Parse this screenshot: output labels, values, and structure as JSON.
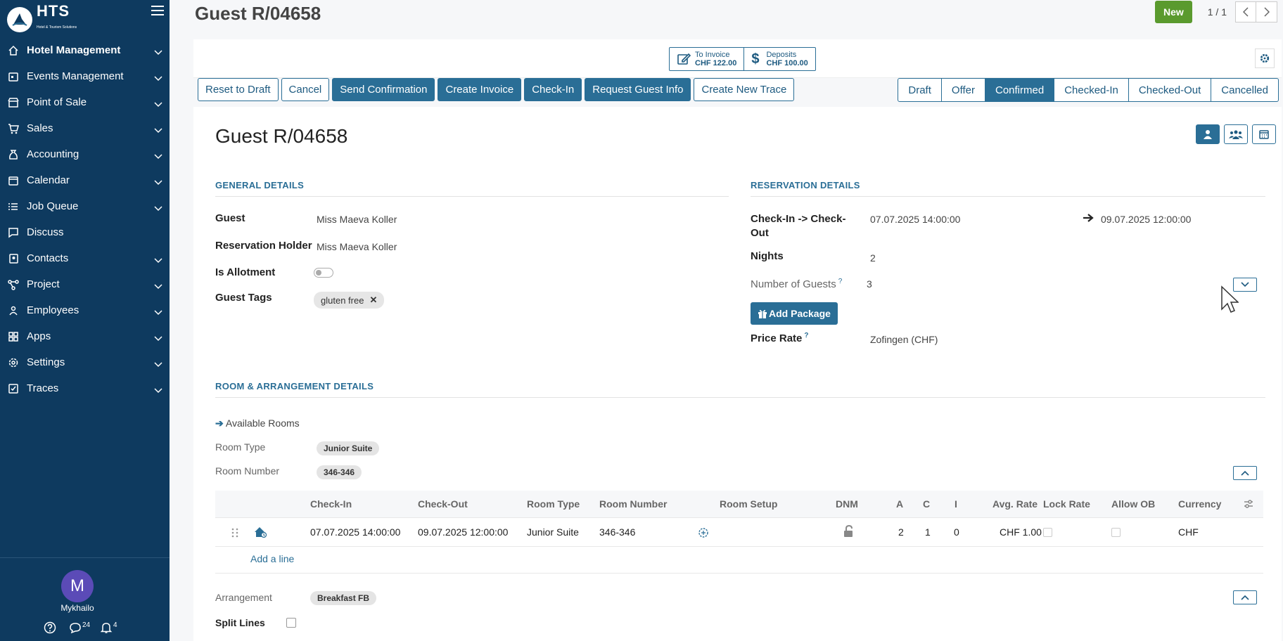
{
  "brand": {
    "name": "HTS",
    "tagline": "Hotel & Tourism Solutions"
  },
  "sidebar": {
    "items": [
      {
        "label": "Hotel Management",
        "icon": "home-icon",
        "active": true,
        "expandable": true
      },
      {
        "label": "Events Management",
        "icon": "calendar-event-icon",
        "expandable": true
      },
      {
        "label": "Point of Sale",
        "icon": "shop-icon",
        "expandable": true
      },
      {
        "label": "Sales",
        "icon": "cart-icon",
        "expandable": true
      },
      {
        "label": "Accounting",
        "icon": "money-bag-icon",
        "expandable": true
      },
      {
        "label": "Calendar",
        "icon": "calendar-icon",
        "expandable": true
      },
      {
        "label": "Job Queue",
        "icon": "list-icon",
        "expandable": true
      },
      {
        "label": "Discuss",
        "icon": "chat-icon",
        "expandable": false
      },
      {
        "label": "Contacts",
        "icon": "address-book-icon",
        "expandable": true
      },
      {
        "label": "Project",
        "icon": "project-icon",
        "expandable": true
      },
      {
        "label": "Employees",
        "icon": "people-icon",
        "expandable": true
      },
      {
        "label": "Apps",
        "icon": "apps-icon",
        "expandable": true
      },
      {
        "label": "Settings",
        "icon": "gear-icon",
        "expandable": true
      },
      {
        "label": "Traces",
        "icon": "checkbox-icon",
        "expandable": true
      }
    ],
    "user": {
      "initial": "M",
      "name": "Mykhailo"
    },
    "messages_count": "24",
    "notifications_count": "4"
  },
  "header": {
    "title": "Guest R/04658",
    "new_label": "New",
    "pager": "1 / 1"
  },
  "smart_buttons": {
    "invoice": {
      "title": "To Invoice",
      "value": "CHF 122.00"
    },
    "deposits": {
      "title": "Deposits",
      "value": "CHF 100.00"
    }
  },
  "actions": [
    "Reset to Draft",
    "Cancel",
    "Send Confirmation",
    "Create Invoice",
    "Check-In",
    "Request Guest Info",
    "Create New Trace"
  ],
  "statuses": [
    "Draft",
    "Offer",
    "Confirmed",
    "Checked-In",
    "Checked-Out",
    "Cancelled"
  ],
  "current_status": "Confirmed",
  "form": {
    "title": "Guest R/04658",
    "general": {
      "heading": "GENERAL DETAILS",
      "guest_label": "Guest",
      "guest": "Miss Maeva Koller",
      "holder_label": "Reservation Holder",
      "holder": "Miss Maeva Koller",
      "allotment_label": "Is Allotment",
      "allotment": false,
      "tags_label": "Guest Tags",
      "tag": "gluten free"
    },
    "reservation": {
      "heading": "RESERVATION DETAILS",
      "checkin_label_1": "Check-In -> Check-",
      "checkin_label_2": "Out",
      "checkin": "07.07.2025 14:00:00",
      "checkout": "09.07.2025 12:00:00",
      "nights_label": "Nights",
      "nights": "2",
      "guests_label": "Number of Guests",
      "guests": "3",
      "add_package": "Add Package",
      "price_rate_label": "Price Rate",
      "price_rate": "Zofingen (CHF)"
    },
    "room": {
      "heading": "ROOM & ARRANGEMENT DETAILS",
      "available_rooms": "Available Rooms",
      "room_type_label": "Room Type",
      "room_type": "Junior Suite",
      "room_number_label": "Room Number",
      "room_number": "346-346",
      "columns": [
        "Check-In",
        "Check-Out",
        "Room Type",
        "Room Number",
        "Room Setup",
        "DNM",
        "A",
        "C",
        "I",
        "Avg. Rate",
        "Lock Rate",
        "Allow OB",
        "Currency"
      ],
      "row": {
        "checkin": "07.07.2025 14:00:00",
        "checkout": "09.07.2025 12:00:00",
        "room_type": "Junior Suite",
        "room_number": "346-346",
        "a": "2",
        "c": "1",
        "i": "0",
        "avg_rate": "CHF 1.00",
        "currency": "CHF"
      },
      "add_line": "Add a line",
      "arrangement_label": "Arrangement",
      "arrangement": "Breakfast FB",
      "split_lines_label": "Split Lines"
    }
  },
  "colors": {
    "sidebar": "#0e3a5f",
    "primary": "#2a6e96",
    "new_button": "#5a9a2e",
    "avatar": "#5b4bb7"
  }
}
